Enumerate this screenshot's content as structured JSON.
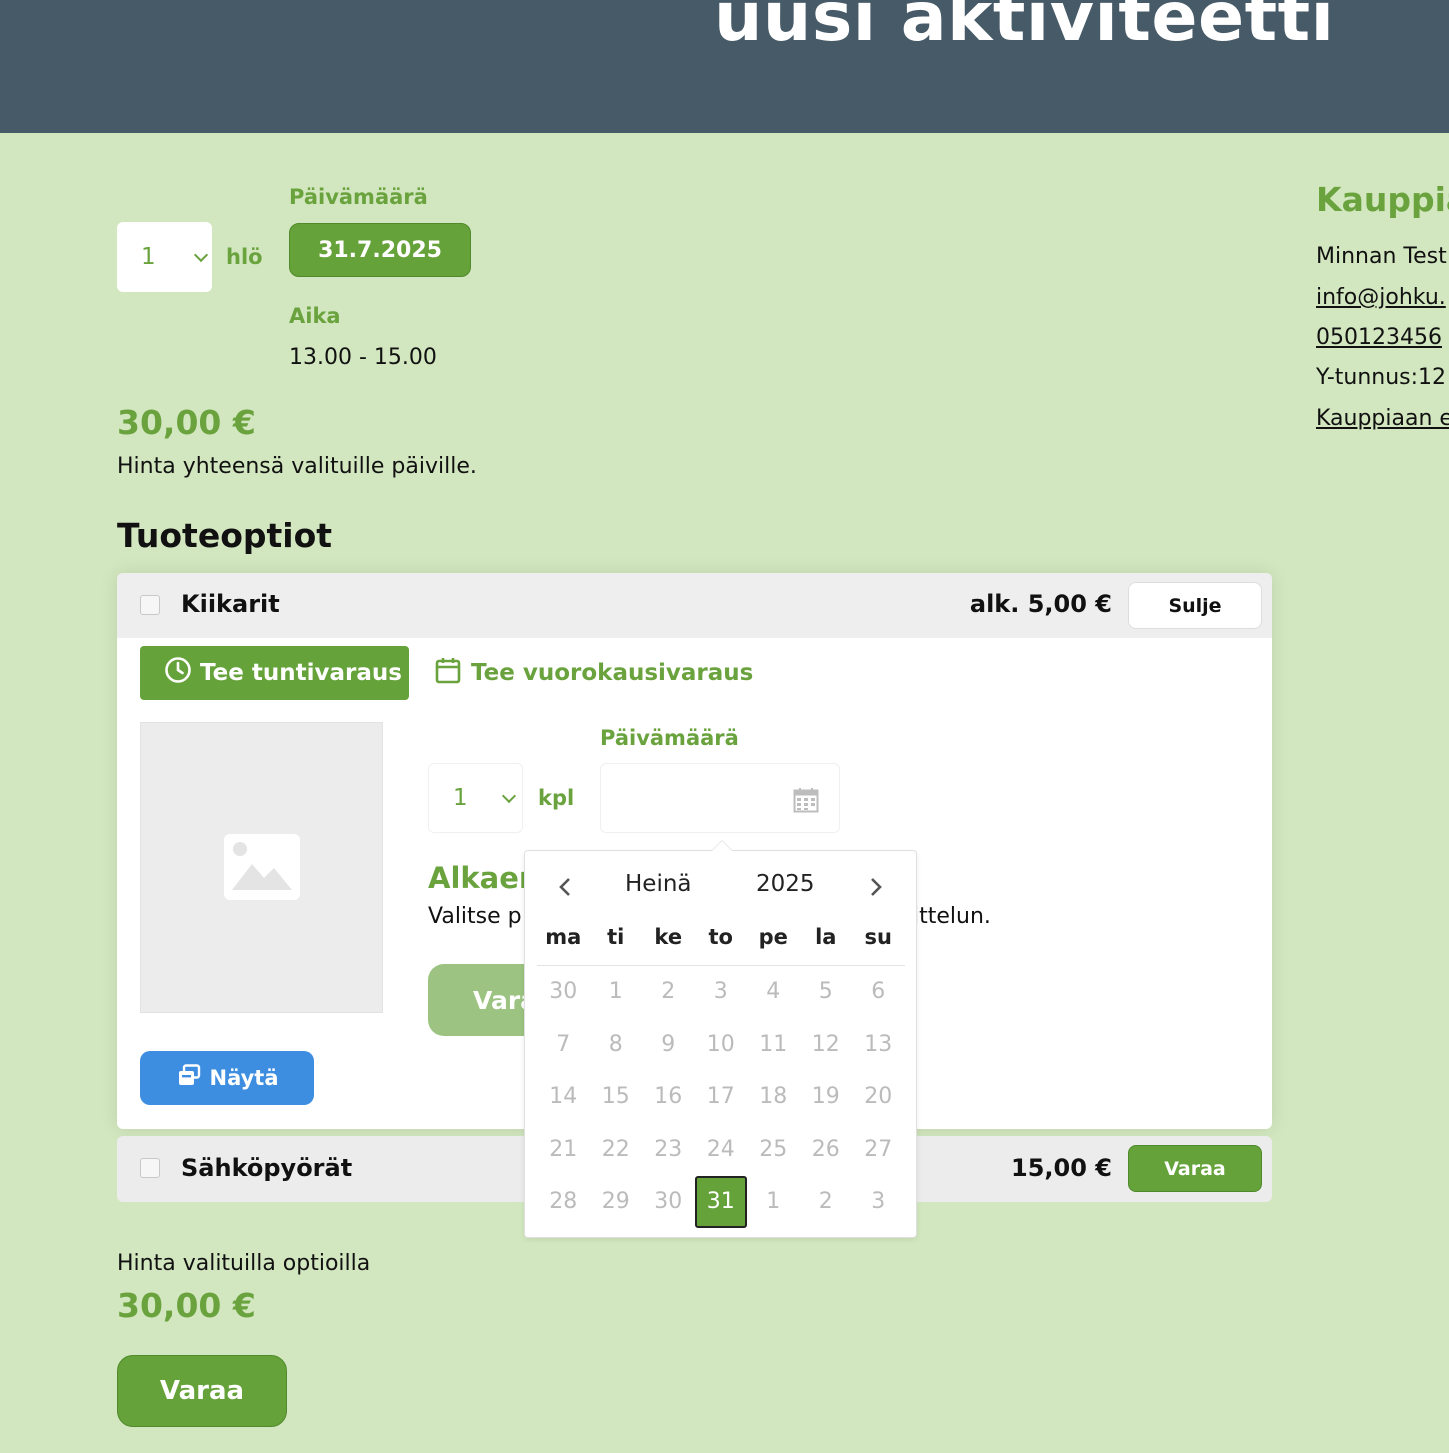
{
  "header": {
    "title": "uusi aktiviteetti"
  },
  "booking": {
    "persons_value": "1",
    "persons_unit": "hlö",
    "date_label": "Päivämäärä",
    "date_value": "31.7.2025",
    "time_label": "Aika",
    "time_value": "13.00 - 15.00",
    "price": "30,00 €",
    "price_note": "Hinta yhteensä valituille päiville."
  },
  "merchant": {
    "title": "Kauppia",
    "name": "Minnan Test",
    "email": "info@johku.",
    "phone": "050123456",
    "business_id": "Y-tunnus:12",
    "terms_link": "Kauppiaan e"
  },
  "options": {
    "title": "Tuoteoptiot",
    "items": [
      {
        "name": "Kiikarit",
        "price": "alk. 5,00 €",
        "button": "Sulje",
        "tab_hourly": "Tee tuntivaraus",
        "tab_daily": "Tee vuorokausivaraus",
        "qty_value": "1",
        "qty_unit": "kpl",
        "date_label": "Päivämäärä",
        "from_label": "Alkaen",
        "instruction_start": "Valitse p",
        "instruction_end": "ittelun.",
        "book_button_partial": "Vara",
        "show_button": "Näytä"
      },
      {
        "name": "Sähköpyörät",
        "price": "15,00 €",
        "button": "Varaa"
      }
    ]
  },
  "summary": {
    "label": "Hinta valituilla optioilla",
    "price": "30,00 €",
    "button": "Varaa"
  },
  "calendar": {
    "month": "Heinä",
    "year": "2025",
    "weekdays": [
      "ma",
      "ti",
      "ke",
      "to",
      "pe",
      "la",
      "su"
    ],
    "weeks": [
      [
        "30",
        "1",
        "2",
        "3",
        "4",
        "5",
        "6"
      ],
      [
        "7",
        "8",
        "9",
        "10",
        "11",
        "12",
        "13"
      ],
      [
        "14",
        "15",
        "16",
        "17",
        "18",
        "19",
        "20"
      ],
      [
        "21",
        "22",
        "23",
        "24",
        "25",
        "26",
        "27"
      ],
      [
        "28",
        "29",
        "30",
        "31",
        "1",
        "2",
        "3"
      ]
    ],
    "selected": "31"
  },
  "colors": {
    "header_bg": "#475a67",
    "page_bg": "#d2e7bf",
    "accent_green": "#66a23a",
    "info_blue": "#3d8ee0"
  },
  "icons": {
    "clock": "clock-icon",
    "calendar": "calendar-icon",
    "image": "image-placeholder-icon",
    "gallery": "gallery-icon"
  }
}
